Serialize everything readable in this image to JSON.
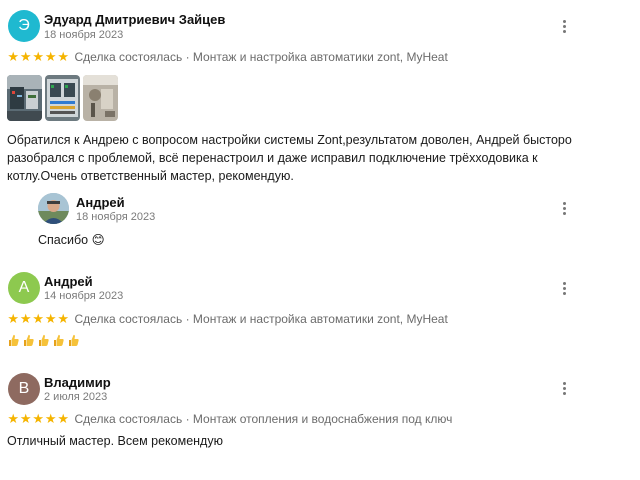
{
  "reviews": [
    {
      "avatar_letter": "Э",
      "avatar_color": "#1fb9d0",
      "name": "Эдуард Дмитриевич Зайцев",
      "date": "18 ноября 2023",
      "rating": 5,
      "deal": "Сделка состоялась · Монтаж и настройка автоматики zont, MyHeat",
      "photos": [
        "photo-equipment-1",
        "photo-equipment-2",
        "photo-equipment-3"
      ],
      "text_lines": [
        "Обратился к Андрею с вопросом настройки системы Zont,результатом доволен, Андрей бысторо",
        "разобрался с проблемой, всё перенастроил и даже исправил подключение трёхходовика к",
        "котлу.Очень ответственный мастер, рекомендую."
      ],
      "reply": {
        "name": "Андрей",
        "date": "18 ноября 2023",
        "text": "Спасибо 😊"
      }
    },
    {
      "avatar_letter": "А",
      "avatar_color": "#8dc94f",
      "name": "Андрей",
      "date": "14 ноября 2023",
      "rating": 5,
      "deal": "Сделка состоялась · Монтаж и настройка автоматики zont, MyHeat",
      "thumbs_count": 5
    },
    {
      "avatar_letter": "В",
      "avatar_color": "#8e6a60",
      "name": "Владимир",
      "date": "2 июля 2023",
      "rating": 5,
      "deal": "Сделка состоялась · Монтаж отопления и водоснабжения под ключ",
      "text": "Отличный мастер. Всем рекомендую"
    }
  ],
  "icons": {
    "star": "star-icon",
    "menu": "more-vertical-icon",
    "thumb": "thumbs-up-icon"
  }
}
